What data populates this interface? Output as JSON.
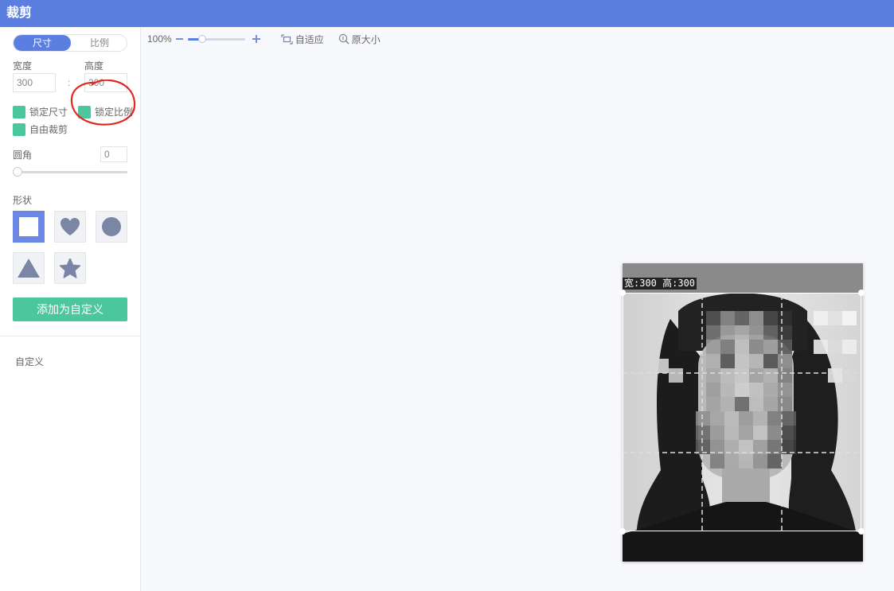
{
  "app": {
    "title": "裁剪"
  },
  "sidebar": {
    "segment": {
      "size_label": "尺寸",
      "ratio_label": "比例"
    },
    "width": {
      "label": "宽度",
      "value": "300"
    },
    "height": {
      "label": "高度",
      "value": "300"
    },
    "checkboxes": {
      "lock_size": "锁定尺寸",
      "lock_ratio": "锁定比例",
      "free_crop": "自由裁剪"
    },
    "corner": {
      "label": "圆角",
      "value": "0"
    },
    "shape": {
      "label": "形状"
    },
    "add_custom_label": "添加为自定义",
    "custom_section_label": "自定义"
  },
  "toolbar": {
    "zoom_percent": "100%",
    "zoom_level": 0.25,
    "fit_label": "自适应",
    "original_size_label": "原大小"
  },
  "canvas": {
    "crop_info": "宽:300 高:300"
  },
  "icons": {
    "zoom_out": "minus-icon",
    "zoom_in": "plus-icon",
    "fit": "fit-screen-icon",
    "original": "magnifier-icon",
    "shapes": [
      "square-icon",
      "heart-icon",
      "circle-icon",
      "triangle-icon",
      "star-icon"
    ]
  },
  "colors": {
    "header": "#5b7fe1",
    "accent_green": "#4cc79d",
    "selected_shape": "#6b86e3",
    "shape_glyph": "#7b86a6",
    "annotation_red": "#e02a1f"
  }
}
